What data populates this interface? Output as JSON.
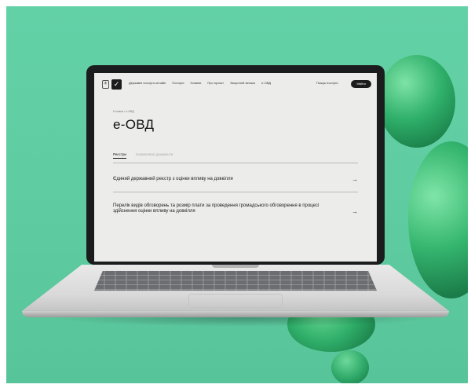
{
  "nav": {
    "items": [
      "Державні послуги онлайн",
      "Послуги",
      "Новини",
      "Про проєкт",
      "Зворотній зв'язок",
      "е-ОВД"
    ],
    "search": "Пошук послуги",
    "button": "Увійти"
  },
  "breadcrumb": "Головна / е-ОВД",
  "title": "е-ОВД",
  "tabs": [
    "Реєстри",
    "Нормативні документи"
  ],
  "list": [
    "Єдиний державний реєстр з оцінки впливу на довкілля",
    "Перелік видів обговорень та розмір плати за проведення громадського обговорення в процесі здійснення оцінки впливу на довкілля"
  ],
  "arrow_icon": "arrow-right-icon"
}
